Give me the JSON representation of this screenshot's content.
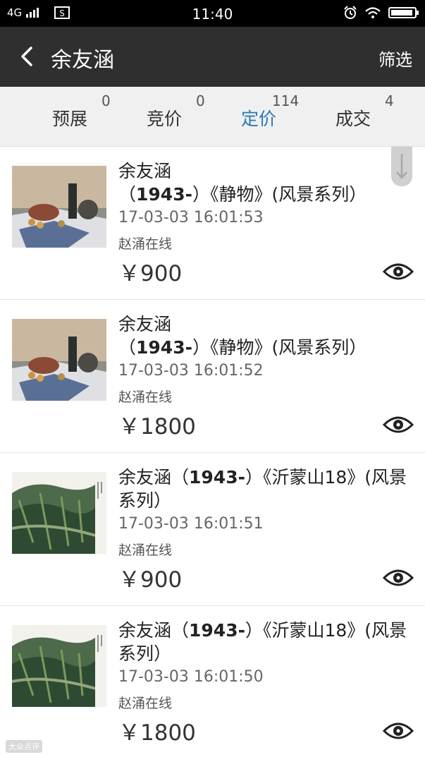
{
  "status_bar": {
    "network": "4G",
    "time": "11:40"
  },
  "header": {
    "title": "余友涵",
    "filter_label": "筛选"
  },
  "tabs": [
    {
      "label": "预展",
      "count": "0"
    },
    {
      "label": "竞价",
      "count": "0"
    },
    {
      "label": "定价",
      "count": "114",
      "active": true
    },
    {
      "label": "成交",
      "count": "4"
    }
  ],
  "items": [
    {
      "title_a": "余友涵（",
      "title_b": "1943-",
      "title_c": "）《静物》(风景系列）",
      "time": "17-03-03 16:01:53",
      "seller": "赵涌在线",
      "price": "￥900",
      "image": "still-life"
    },
    {
      "title_a": "余友涵（",
      "title_b": "1943-",
      "title_c": "）《静物》(风景系列）",
      "time": "17-03-03 16:01:52",
      "seller": "赵涌在线",
      "price": "￥1800",
      "image": "still-life"
    },
    {
      "title_a": "余友涵（",
      "title_b": "1943-",
      "title_c": "）《沂蒙山18》(风景系列）",
      "time": "17-03-03 16:01:51",
      "seller": "赵涌在线",
      "price": "￥900",
      "image": "landscape"
    },
    {
      "title_a": "余友涵（",
      "title_b": "1943-",
      "title_c": "）《沂蒙山18》(风景系列）",
      "time": "17-03-03 16:01:50",
      "seller": "赵涌在线",
      "price": "￥1800",
      "image": "landscape"
    }
  ],
  "watermark": "大众点评",
  "colors": {
    "header_bg": "#2f2f2f",
    "tab_bar_bg": "#f0f0f0",
    "active_tab": "#2a79b5"
  }
}
